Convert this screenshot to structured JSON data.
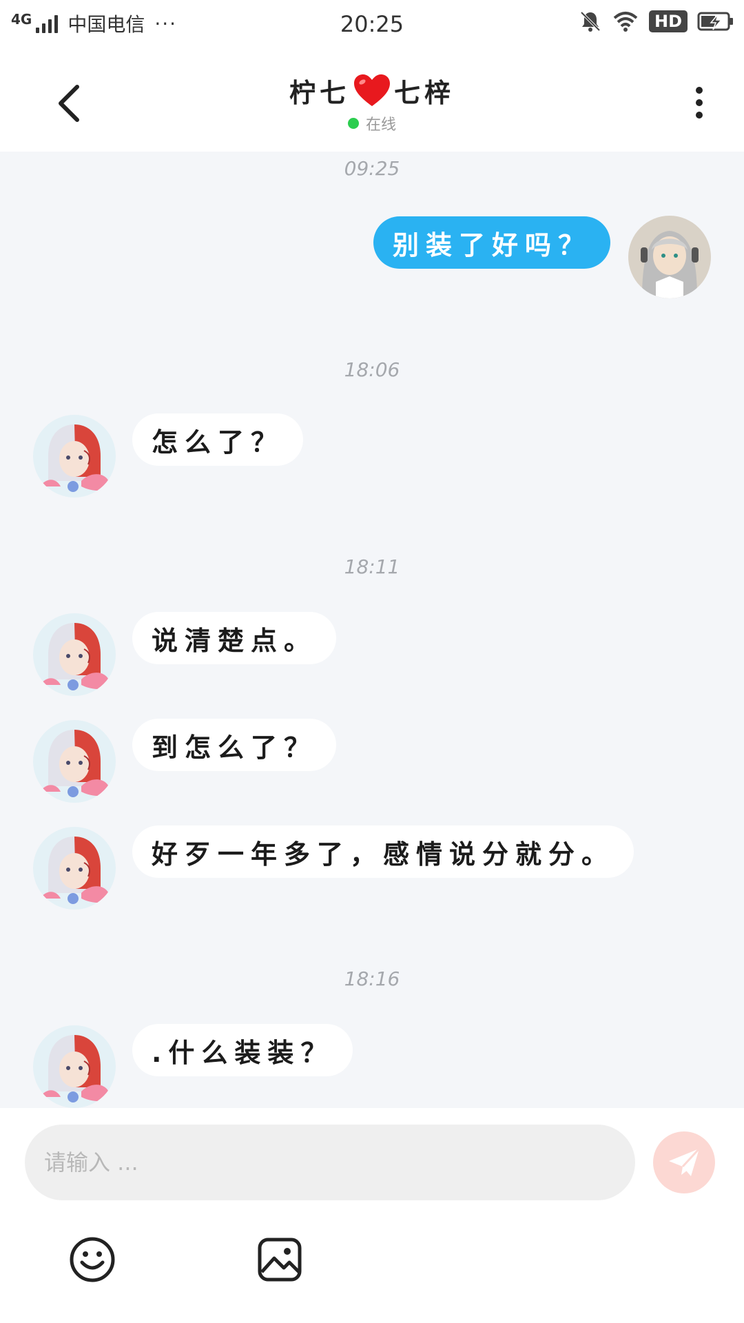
{
  "status_bar": {
    "network": "4G",
    "carrier": "中国电信",
    "more": "···",
    "time": "20:25",
    "hd": "HD"
  },
  "header": {
    "name_left": "柠七",
    "name_right": "七梓",
    "status": "在线"
  },
  "messages": [
    {
      "timestamp": "09:25"
    },
    {
      "direction": "out",
      "text": "别装了好吗？"
    },
    {
      "timestamp": "18:06"
    },
    {
      "direction": "in",
      "text": "怎么了？"
    },
    {
      "timestamp": "18:11"
    },
    {
      "direction": "in",
      "text": "说清楚点。"
    },
    {
      "direction": "in",
      "text": "到怎么了？"
    },
    {
      "direction": "in",
      "text": "好歹一年多了，感情说分就分。"
    },
    {
      "timestamp": "18:16"
    },
    {
      "direction": "in",
      "text": ".什么装装？"
    }
  ],
  "composer": {
    "placeholder": "请输入 ..."
  },
  "colors": {
    "outgoing_bubble": "#2ab2f2",
    "incoming_bubble": "#ffffff",
    "chat_background": "#f4f6f9",
    "online_dot": "#2ccd4f",
    "send_button": "#fcd8d3"
  },
  "icons": [
    "back-arrow-icon",
    "more-vertical-icon",
    "heart-icon",
    "emoji-icon",
    "image-icon",
    "send-icon",
    "bell-muted-icon",
    "wifi-icon",
    "battery-charging-icon",
    "signal-icon"
  ]
}
